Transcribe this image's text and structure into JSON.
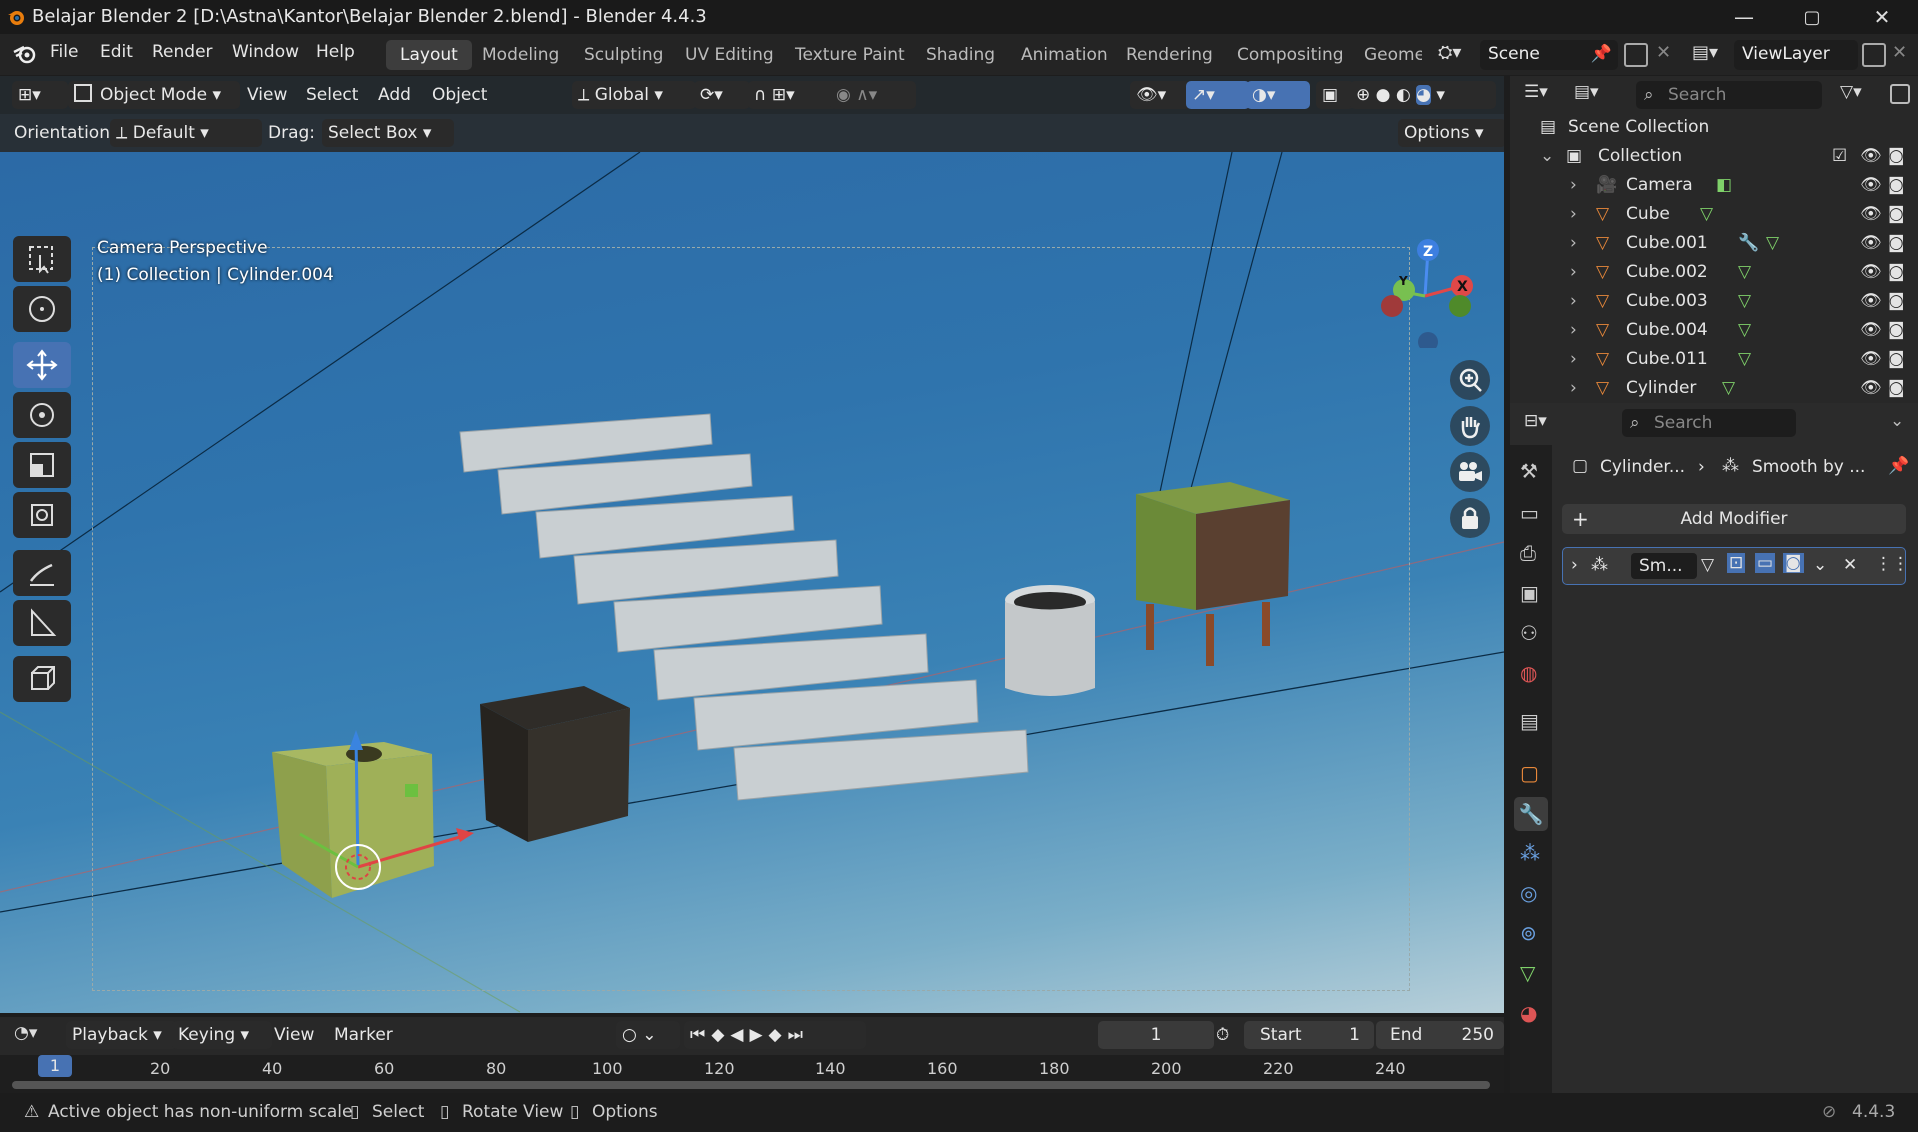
{
  "window": {
    "title": "Belajar Blender 2 [D:\\Astna\\Kantor\\Belajar Blender 2.blend] - Blender 4.4.3",
    "minimize": "—",
    "maximize": "▢",
    "close": "✕"
  },
  "menubar": {
    "menus": [
      "File",
      "Edit",
      "Render",
      "Window",
      "Help"
    ],
    "workspaces": [
      "Layout",
      "Modeling",
      "Sculpting",
      "UV Editing",
      "Texture Paint",
      "Shading",
      "Animation",
      "Rendering",
      "Compositing",
      "Geome"
    ],
    "active_workspace": "Layout",
    "scene": "Scene",
    "view_layer": "ViewLayer"
  },
  "viewport_header": {
    "mode": "Object Mode",
    "menus": [
      "View",
      "Select",
      "Add",
      "Object"
    ],
    "transform_orientation": "Global"
  },
  "tool_settings": {
    "orientation_label": "Orientation:",
    "orientation_value": "Default",
    "drag_label": "Drag:",
    "drag_value": "Select Box",
    "options": "Options"
  },
  "viewport_overlay": {
    "line1": "Camera Perspective",
    "line2": "(1) Collection | Cylinder.004"
  },
  "gizmo": {
    "z": "Z",
    "y": "Y",
    "x": "X"
  },
  "outliner": {
    "search_placeholder": "Search",
    "scene_collection": "Scene Collection",
    "collection": "Collection",
    "items": [
      {
        "name": "Camera"
      },
      {
        "name": "Cube"
      },
      {
        "name": "Cube.001"
      },
      {
        "name": "Cube.002"
      },
      {
        "name": "Cube.003"
      },
      {
        "name": "Cube.004"
      },
      {
        "name": "Cube.011"
      },
      {
        "name": "Cylinder"
      }
    ]
  },
  "properties": {
    "search_placeholder": "Search",
    "breadcrumb_object": "Cylinder...",
    "breadcrumb_modifier": "Smooth by ...",
    "add_modifier": "Add Modifier",
    "modifier_name": "Sm..."
  },
  "timeline": {
    "menus": [
      "Playback",
      "Keying",
      "View",
      "Marker"
    ],
    "current_frame": "1",
    "start_label": "Start",
    "start_value": "1",
    "end_label": "End",
    "end_value": "250",
    "ruler_current": "1",
    "ticks": [
      "20",
      "40",
      "60",
      "80",
      "100",
      "120",
      "140",
      "160",
      "180",
      "200",
      "220",
      "240"
    ]
  },
  "statusbar": {
    "warning": "Active object has non-uniform scale",
    "hint_select": "Select",
    "hint_rotate": "Rotate View",
    "hint_options": "Options",
    "version": "4.4.3"
  },
  "colors": {
    "accent": "#4772b3",
    "orange": "#e8883a",
    "mesh_green": "#7fd16a"
  }
}
